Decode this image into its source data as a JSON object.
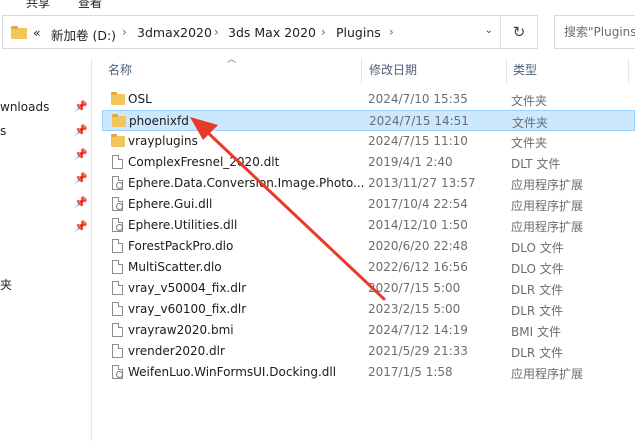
{
  "ribbon": {
    "tab_share": "共享",
    "tab_view": "查看"
  },
  "address_bar": {
    "back_chevrons": "«",
    "segments": [
      "新加卷 (D:)",
      "3dmax2020",
      "3ds Max 2020",
      "Plugins"
    ],
    "separator": "›",
    "dropdown": "⌄",
    "refresh": "↻"
  },
  "search": {
    "placeholder": "搜索\"Plugins"
  },
  "nav": {
    "items": [
      {
        "label": "wnloads",
        "pinned": true
      },
      {
        "label": "s",
        "pinned": true
      },
      {
        "label": "",
        "pinned": true
      },
      {
        "label": "",
        "pinned": true
      },
      {
        "label": "",
        "pinned": true
      },
      {
        "label": "",
        "pinned": true
      },
      {
        "label": "夹",
        "pinned": false
      }
    ],
    "pin_glyph": "📌"
  },
  "columns": {
    "name": "名称",
    "date": "修改日期",
    "type": "类型"
  },
  "files": [
    {
      "name": "OSL",
      "date": "2024/7/10 15:35",
      "type": "文件夹",
      "kind": "folder",
      "selected": false
    },
    {
      "name": "phoenixfd",
      "date": "2024/7/15 14:51",
      "type": "文件夹",
      "kind": "folder",
      "selected": true
    },
    {
      "name": "vrayplugins",
      "date": "2024/7/15 11:10",
      "type": "文件夹",
      "kind": "folder",
      "selected": false
    },
    {
      "name": "ComplexFresnel_2020.dlt",
      "date": "2019/4/1 2:40",
      "type": "DLT 文件",
      "kind": "file",
      "selected": false
    },
    {
      "name": "Ephere.Data.Conversion.Image.Photo...",
      "date": "2013/11/27 13:57",
      "type": "应用程序扩展",
      "kind": "dll",
      "selected": false
    },
    {
      "name": "Ephere.Gui.dll",
      "date": "2017/10/4 22:54",
      "type": "应用程序扩展",
      "kind": "dll",
      "selected": false
    },
    {
      "name": "Ephere.Utilities.dll",
      "date": "2014/12/10 1:50",
      "type": "应用程序扩展",
      "kind": "dll",
      "selected": false
    },
    {
      "name": "ForestPackPro.dlo",
      "date": "2020/6/20 22:48",
      "type": "DLO 文件",
      "kind": "file",
      "selected": false
    },
    {
      "name": "MultiScatter.dlo",
      "date": "2022/6/12 16:56",
      "type": "DLO 文件",
      "kind": "file",
      "selected": false
    },
    {
      "name": "vray_v50004_fix.dlr",
      "date": "2020/7/15 5:00",
      "type": "DLR 文件",
      "kind": "file",
      "selected": false
    },
    {
      "name": "vray_v60100_fix.dlr",
      "date": "2023/2/15 5:00",
      "type": "DLR 文件",
      "kind": "file",
      "selected": false
    },
    {
      "name": "vrayraw2020.bmi",
      "date": "2024/7/12 14:19",
      "type": "BMI 文件",
      "kind": "file",
      "selected": false
    },
    {
      "name": "vrender2020.dlr",
      "date": "2021/5/29 21:33",
      "type": "DLR 文件",
      "kind": "file",
      "selected": false
    },
    {
      "name": "WeifenLuo.WinFormsUI.Docking.dll",
      "date": "2017/1/5 1:58",
      "type": "应用程序扩展",
      "kind": "dll",
      "selected": false
    }
  ],
  "colors": {
    "selection": "#cce8ff",
    "selection_border": "#99d1ff",
    "folder": "#f2c55c",
    "annotation_arrow": "#e8392b",
    "header_text": "#4c607a"
  }
}
